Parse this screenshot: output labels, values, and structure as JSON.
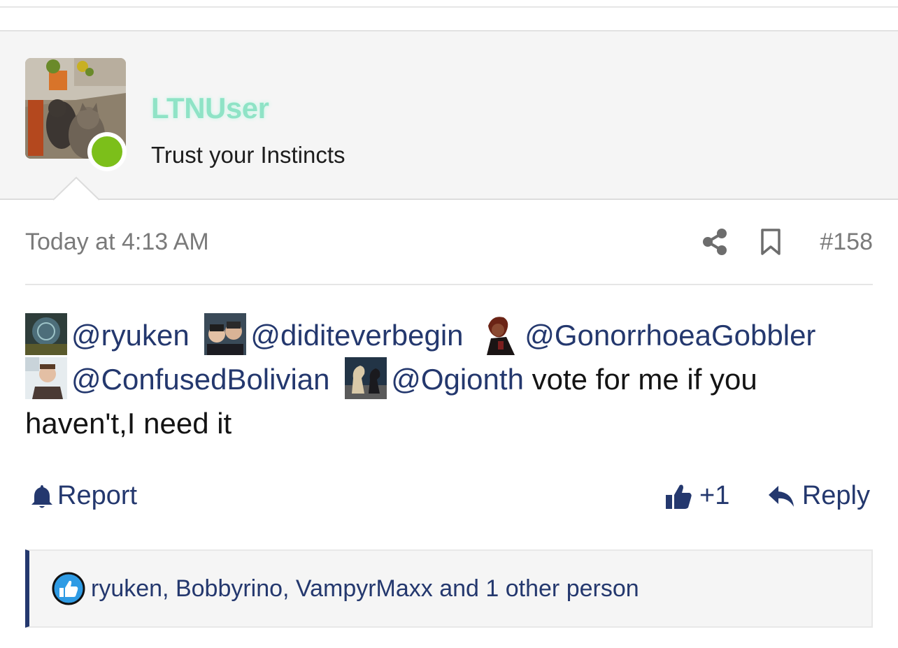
{
  "user": {
    "username": "LTNUser",
    "title": "Trust your Instincts",
    "avatar_icon": "cats-photo-avatar",
    "status": "online",
    "status_color": "#7cbf1a",
    "username_color": "#8fe3c6"
  },
  "post": {
    "timestamp": "Today at 4:13 AM",
    "number": "#158",
    "icons": [
      "share-icon",
      "bookmark-icon"
    ],
    "message": {
      "mentions": [
        {
          "handle": "@ryuken",
          "avatar": "ryuken-avatar"
        },
        {
          "handle": "@diditeverbegin",
          "avatar": "diditeverbegin-avatar"
        },
        {
          "handle": "@GonorrhoeaGobbler",
          "avatar": "gonorrhoeagobbler-avatar"
        },
        {
          "handle": "@ConfusedBolivian",
          "avatar": "confusedbolivian-avatar"
        },
        {
          "handle": "@Ogionth",
          "avatar": "ogionth-avatar"
        }
      ],
      "text_part1": " vote for me if you",
      "text_part2": "haven't,I need it"
    }
  },
  "actions": {
    "report_label": "Report",
    "like_label": "+1",
    "reply_label": "Reply",
    "link_color": "#24386e"
  },
  "likes": {
    "summary": "ryuken, Bobbyrino, VampyrMaxx and 1 other person"
  }
}
